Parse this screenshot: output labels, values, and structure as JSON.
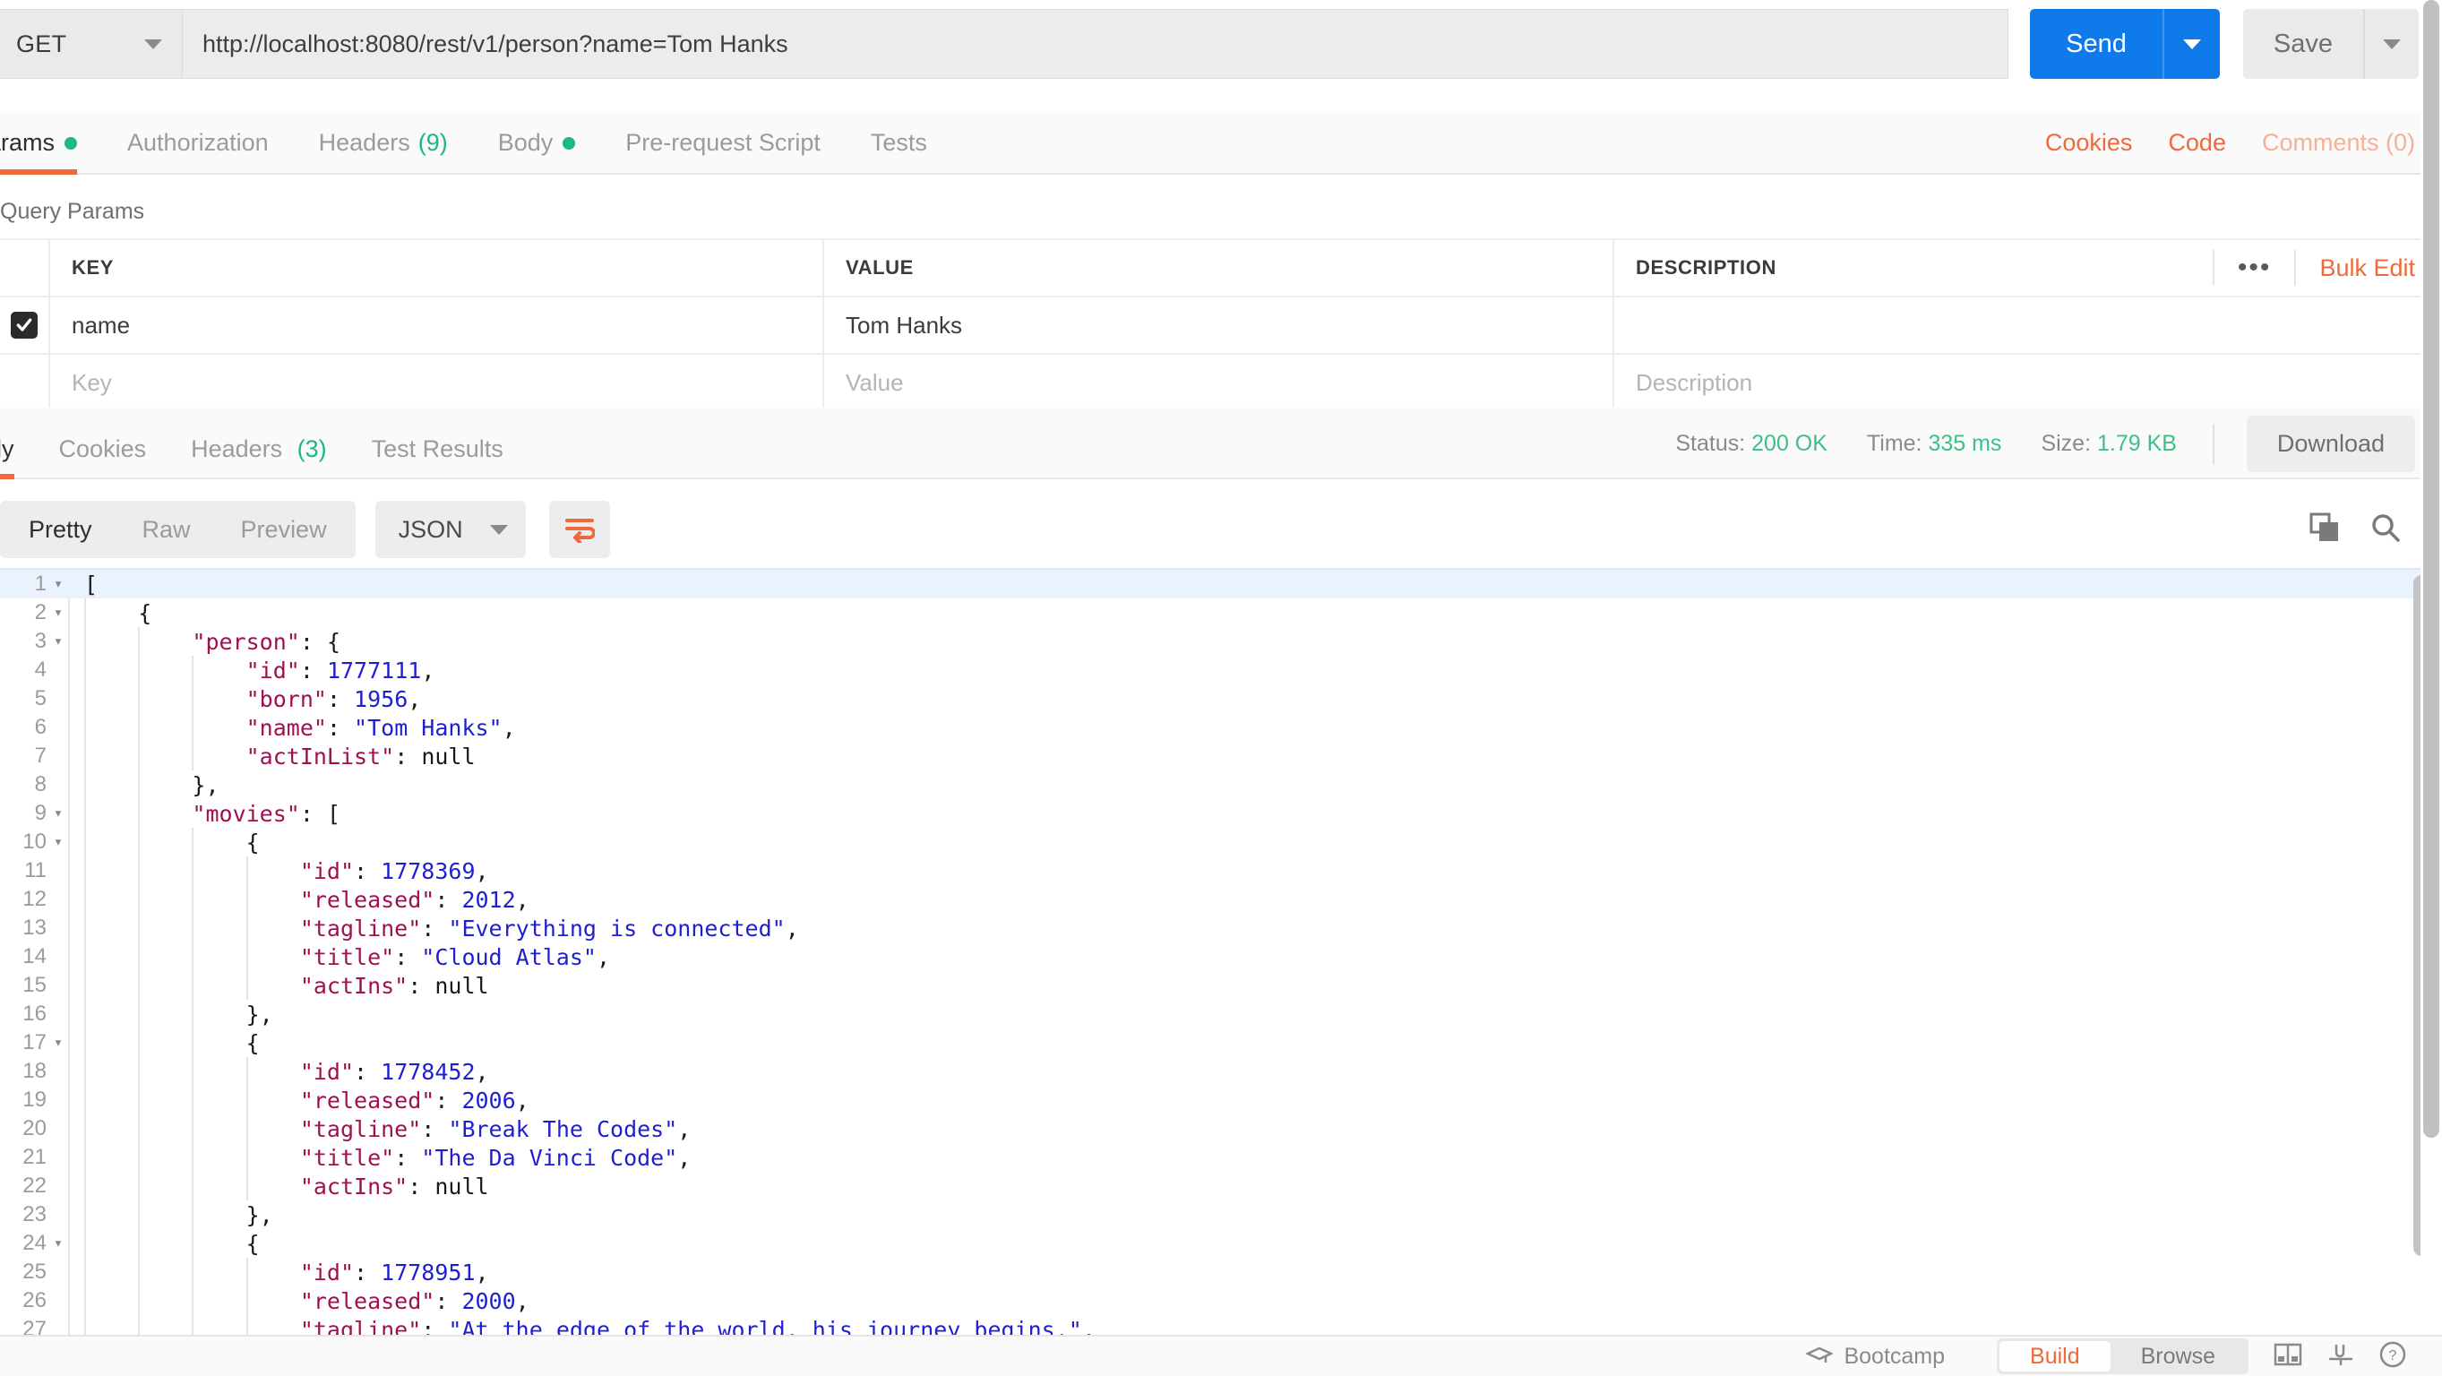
{
  "request": {
    "method": "GET",
    "url": "http://localhost:8080/rest/v1/person?name=Tom Hanks",
    "send_label": "Send",
    "save_label": "Save",
    "tabs": [
      {
        "label": "Params",
        "badge_dot": true,
        "active": true
      },
      {
        "label": "Authorization",
        "active": false
      },
      {
        "label": "Headers",
        "count": "(9)",
        "active": false
      },
      {
        "label": "Body",
        "badge_dot": true,
        "active": false
      },
      {
        "label": "Pre-request Script",
        "active": false
      },
      {
        "label": "Tests",
        "active": false
      }
    ],
    "right_links": [
      {
        "label": "Cookies",
        "style": "orange"
      },
      {
        "label": "Code",
        "style": "orange"
      },
      {
        "label": "Comments (0)",
        "style": "orange-faded"
      }
    ]
  },
  "query_params": {
    "title": "Query Params",
    "columns": [
      "KEY",
      "VALUE",
      "DESCRIPTION"
    ],
    "bulk_edit_label": "Bulk Edit",
    "more_icon": "•••",
    "rows": [
      {
        "checked": true,
        "key": "name",
        "value": "Tom Hanks",
        "description": ""
      }
    ],
    "placeholder_row": {
      "key": "Key",
      "value": "Value",
      "description": "Description"
    }
  },
  "response": {
    "tabs": [
      {
        "label": "ody",
        "active": true
      },
      {
        "label": "Cookies",
        "active": false
      },
      {
        "label": "Headers",
        "count": "(3)",
        "active": false
      },
      {
        "label": "Test Results",
        "active": false
      }
    ],
    "status_label": "Status:",
    "status_value": "200 OK",
    "time_label": "Time:",
    "time_value": "335 ms",
    "size_label": "Size:",
    "size_value": "1.79 KB",
    "download_label": "Download",
    "viewer": {
      "modes": [
        {
          "label": "Pretty",
          "active": true
        },
        {
          "label": "Raw",
          "active": false
        },
        {
          "label": "Preview",
          "active": false
        }
      ],
      "format": "JSON"
    },
    "body_lines": [
      {
        "n": "1",
        "fold": "▾",
        "highlight": true,
        "indent": 0,
        "tokens": [
          {
            "t": "[",
            "c": "p"
          }
        ]
      },
      {
        "n": "2",
        "fold": "▾",
        "indent": 1,
        "tokens": [
          {
            "t": "{",
            "c": "p"
          }
        ]
      },
      {
        "n": "3",
        "fold": "▾",
        "indent": 2,
        "tokens": [
          {
            "t": "\"person\"",
            "c": "k"
          },
          {
            "t": ": ",
            "c": "p"
          },
          {
            "t": "{",
            "c": "p"
          }
        ]
      },
      {
        "n": "4",
        "fold": "",
        "indent": 3,
        "tokens": [
          {
            "t": "\"id\"",
            "c": "k"
          },
          {
            "t": ": ",
            "c": "p"
          },
          {
            "t": "1777111",
            "c": "v"
          },
          {
            "t": ",",
            "c": "p"
          }
        ]
      },
      {
        "n": "5",
        "fold": "",
        "indent": 3,
        "tokens": [
          {
            "t": "\"born\"",
            "c": "k"
          },
          {
            "t": ": ",
            "c": "p"
          },
          {
            "t": "1956",
            "c": "v"
          },
          {
            "t": ",",
            "c": "p"
          }
        ]
      },
      {
        "n": "6",
        "fold": "",
        "indent": 3,
        "tokens": [
          {
            "t": "\"name\"",
            "c": "k"
          },
          {
            "t": ": ",
            "c": "p"
          },
          {
            "t": "\"Tom Hanks\"",
            "c": "v"
          },
          {
            "t": ",",
            "c": "p"
          }
        ]
      },
      {
        "n": "7",
        "fold": "",
        "indent": 3,
        "tokens": [
          {
            "t": "\"actInList\"",
            "c": "k"
          },
          {
            "t": ": ",
            "c": "p"
          },
          {
            "t": "null",
            "c": "n"
          }
        ]
      },
      {
        "n": "8",
        "fold": "",
        "indent": 2,
        "tokens": [
          {
            "t": "},",
            "c": "p"
          }
        ]
      },
      {
        "n": "9",
        "fold": "▾",
        "indent": 2,
        "tokens": [
          {
            "t": "\"movies\"",
            "c": "k"
          },
          {
            "t": ": ",
            "c": "p"
          },
          {
            "t": "[",
            "c": "p"
          }
        ]
      },
      {
        "n": "10",
        "fold": "▾",
        "indent": 3,
        "tokens": [
          {
            "t": "{",
            "c": "p"
          }
        ]
      },
      {
        "n": "11",
        "fold": "",
        "indent": 4,
        "tokens": [
          {
            "t": "\"id\"",
            "c": "k"
          },
          {
            "t": ": ",
            "c": "p"
          },
          {
            "t": "1778369",
            "c": "v"
          },
          {
            "t": ",",
            "c": "p"
          }
        ]
      },
      {
        "n": "12",
        "fold": "",
        "indent": 4,
        "tokens": [
          {
            "t": "\"released\"",
            "c": "k"
          },
          {
            "t": ": ",
            "c": "p"
          },
          {
            "t": "2012",
            "c": "v"
          },
          {
            "t": ",",
            "c": "p"
          }
        ]
      },
      {
        "n": "13",
        "fold": "",
        "indent": 4,
        "tokens": [
          {
            "t": "\"tagline\"",
            "c": "k"
          },
          {
            "t": ": ",
            "c": "p"
          },
          {
            "t": "\"Everything is connected\"",
            "c": "v"
          },
          {
            "t": ",",
            "c": "p"
          }
        ]
      },
      {
        "n": "14",
        "fold": "",
        "indent": 4,
        "tokens": [
          {
            "t": "\"title\"",
            "c": "k"
          },
          {
            "t": ": ",
            "c": "p"
          },
          {
            "t": "\"Cloud Atlas\"",
            "c": "v"
          },
          {
            "t": ",",
            "c": "p"
          }
        ]
      },
      {
        "n": "15",
        "fold": "",
        "indent": 4,
        "tokens": [
          {
            "t": "\"actIns\"",
            "c": "k"
          },
          {
            "t": ": ",
            "c": "p"
          },
          {
            "t": "null",
            "c": "n"
          }
        ]
      },
      {
        "n": "16",
        "fold": "",
        "indent": 3,
        "tokens": [
          {
            "t": "},",
            "c": "p"
          }
        ]
      },
      {
        "n": "17",
        "fold": "▾",
        "indent": 3,
        "tokens": [
          {
            "t": "{",
            "c": "p"
          }
        ]
      },
      {
        "n": "18",
        "fold": "",
        "indent": 4,
        "tokens": [
          {
            "t": "\"id\"",
            "c": "k"
          },
          {
            "t": ": ",
            "c": "p"
          },
          {
            "t": "1778452",
            "c": "v"
          },
          {
            "t": ",",
            "c": "p"
          }
        ]
      },
      {
        "n": "19",
        "fold": "",
        "indent": 4,
        "tokens": [
          {
            "t": "\"released\"",
            "c": "k"
          },
          {
            "t": ": ",
            "c": "p"
          },
          {
            "t": "2006",
            "c": "v"
          },
          {
            "t": ",",
            "c": "p"
          }
        ]
      },
      {
        "n": "20",
        "fold": "",
        "indent": 4,
        "tokens": [
          {
            "t": "\"tagline\"",
            "c": "k"
          },
          {
            "t": ": ",
            "c": "p"
          },
          {
            "t": "\"Break The Codes\"",
            "c": "v"
          },
          {
            "t": ",",
            "c": "p"
          }
        ]
      },
      {
        "n": "21",
        "fold": "",
        "indent": 4,
        "tokens": [
          {
            "t": "\"title\"",
            "c": "k"
          },
          {
            "t": ": ",
            "c": "p"
          },
          {
            "t": "\"The Da Vinci Code\"",
            "c": "v"
          },
          {
            "t": ",",
            "c": "p"
          }
        ]
      },
      {
        "n": "22",
        "fold": "",
        "indent": 4,
        "tokens": [
          {
            "t": "\"actIns\"",
            "c": "k"
          },
          {
            "t": ": ",
            "c": "p"
          },
          {
            "t": "null",
            "c": "n"
          }
        ]
      },
      {
        "n": "23",
        "fold": "",
        "indent": 3,
        "tokens": [
          {
            "t": "},",
            "c": "p"
          }
        ]
      },
      {
        "n": "24",
        "fold": "▾",
        "indent": 3,
        "tokens": [
          {
            "t": "{",
            "c": "p"
          }
        ]
      },
      {
        "n": "25",
        "fold": "",
        "indent": 4,
        "tokens": [
          {
            "t": "\"id\"",
            "c": "k"
          },
          {
            "t": ": ",
            "c": "p"
          },
          {
            "t": "1778951",
            "c": "v"
          },
          {
            "t": ",",
            "c": "p"
          }
        ]
      },
      {
        "n": "26",
        "fold": "",
        "indent": 4,
        "tokens": [
          {
            "t": "\"released\"",
            "c": "k"
          },
          {
            "t": ": ",
            "c": "p"
          },
          {
            "t": "2000",
            "c": "v"
          },
          {
            "t": ",",
            "c": "p"
          }
        ]
      },
      {
        "n": "27",
        "fold": "",
        "indent": 4,
        "tokens": [
          {
            "t": "\"tagline\"",
            "c": "k"
          },
          {
            "t": ": ",
            "c": "p"
          },
          {
            "t": "\"At the edge of the world, his journey begins.\"",
            "c": "v"
          },
          {
            "t": ",",
            "c": "p"
          }
        ]
      }
    ]
  },
  "bottom_bar": {
    "bootcamp_label": "Bootcamp",
    "toggles": [
      {
        "label": "Build",
        "active": true
      },
      {
        "label": "Browse",
        "active": false
      }
    ]
  },
  "colors": {
    "accent_orange": "#f0693a",
    "send_blue": "#0f7beb",
    "status_green": "#3fbf85",
    "badge_green": "#1bb980",
    "json_key": "#a11050",
    "json_value": "#1f1fd0"
  }
}
